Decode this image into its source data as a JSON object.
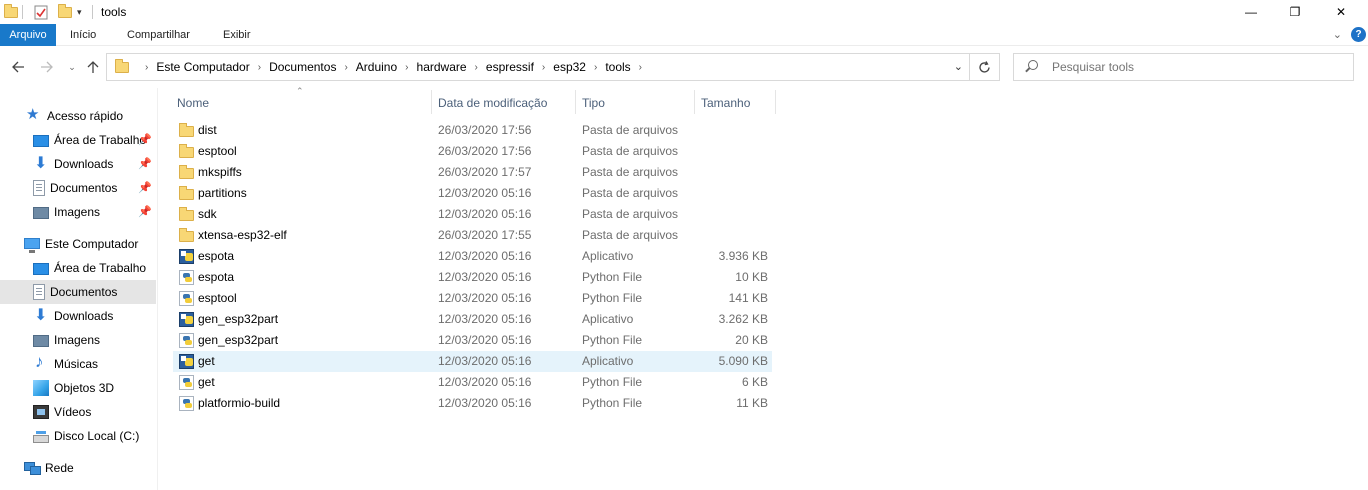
{
  "window": {
    "title": "tools",
    "minimize": "—",
    "maximize": "❐",
    "close": "✕"
  },
  "ribbon": {
    "tabs": [
      "Arquivo",
      "Início",
      "Compartilhar",
      "Exibir"
    ],
    "accent": "#1979ca"
  },
  "address": {
    "crumbs": [
      "Este Computador",
      "Documentos",
      "Arduino",
      "hardware",
      "espressif",
      "esp32",
      "tools"
    ],
    "search_placeholder": "Pesquisar tools"
  },
  "nav": {
    "quick_access": "Acesso rápido",
    "quick_items": [
      {
        "label": "Área de Trabalho",
        "icon": "desktop-icon"
      },
      {
        "label": "Downloads",
        "icon": "download-icon"
      },
      {
        "label": "Documentos",
        "icon": "documents-icon"
      },
      {
        "label": "Imagens",
        "icon": "pictures-icon"
      }
    ],
    "this_pc": "Este Computador",
    "pc_items": [
      {
        "label": "Área de Trabalho",
        "icon": "desktop-icon"
      },
      {
        "label": "Documentos",
        "icon": "documents-icon",
        "selected": true
      },
      {
        "label": "Downloads",
        "icon": "download-icon"
      },
      {
        "label": "Imagens",
        "icon": "pictures-icon"
      },
      {
        "label": "Músicas",
        "icon": "music-icon"
      },
      {
        "label": "Objetos 3D",
        "icon": "objects-3d-icon"
      },
      {
        "label": "Vídeos",
        "icon": "videos-icon"
      },
      {
        "label": "Disco Local (C:)",
        "icon": "local-disk-icon"
      }
    ],
    "network": "Rede"
  },
  "columns": {
    "name": "Nome",
    "date": "Data de modificação",
    "type": "Tipo",
    "size": "Tamanho"
  },
  "files": [
    {
      "name": "dist",
      "date": "26/03/2020 17:56",
      "type": "Pasta de arquivos",
      "size": "",
      "kind": "folder"
    },
    {
      "name": "esptool",
      "date": "26/03/2020 17:56",
      "type": "Pasta de arquivos",
      "size": "",
      "kind": "folder"
    },
    {
      "name": "mkspiffs",
      "date": "26/03/2020 17:57",
      "type": "Pasta de arquivos",
      "size": "",
      "kind": "folder"
    },
    {
      "name": "partitions",
      "date": "12/03/2020 05:16",
      "type": "Pasta de arquivos",
      "size": "",
      "kind": "folder"
    },
    {
      "name": "sdk",
      "date": "12/03/2020 05:16",
      "type": "Pasta de arquivos",
      "size": "",
      "kind": "folder"
    },
    {
      "name": "xtensa-esp32-elf",
      "date": "26/03/2020 17:55",
      "type": "Pasta de arquivos",
      "size": "",
      "kind": "folder"
    },
    {
      "name": "espota",
      "date": "12/03/2020 05:16",
      "type": "Aplicativo",
      "size": "3.936 KB",
      "kind": "app"
    },
    {
      "name": "espota",
      "date": "12/03/2020 05:16",
      "type": "Python File",
      "size": "10 KB",
      "kind": "py"
    },
    {
      "name": "esptool",
      "date": "12/03/2020 05:16",
      "type": "Python File",
      "size": "141 KB",
      "kind": "py"
    },
    {
      "name": "gen_esp32part",
      "date": "12/03/2020 05:16",
      "type": "Aplicativo",
      "size": "3.262 KB",
      "kind": "app"
    },
    {
      "name": "gen_esp32part",
      "date": "12/03/2020 05:16",
      "type": "Python File",
      "size": "20 KB",
      "kind": "py"
    },
    {
      "name": "get",
      "date": "12/03/2020 05:16",
      "type": "Aplicativo",
      "size": "5.090 KB",
      "kind": "app",
      "hover": true
    },
    {
      "name": "get",
      "date": "12/03/2020 05:16",
      "type": "Python File",
      "size": "6 KB",
      "kind": "py"
    },
    {
      "name": "platformio-build",
      "date": "12/03/2020 05:16",
      "type": "Python File",
      "size": "11 KB",
      "kind": "py"
    }
  ]
}
